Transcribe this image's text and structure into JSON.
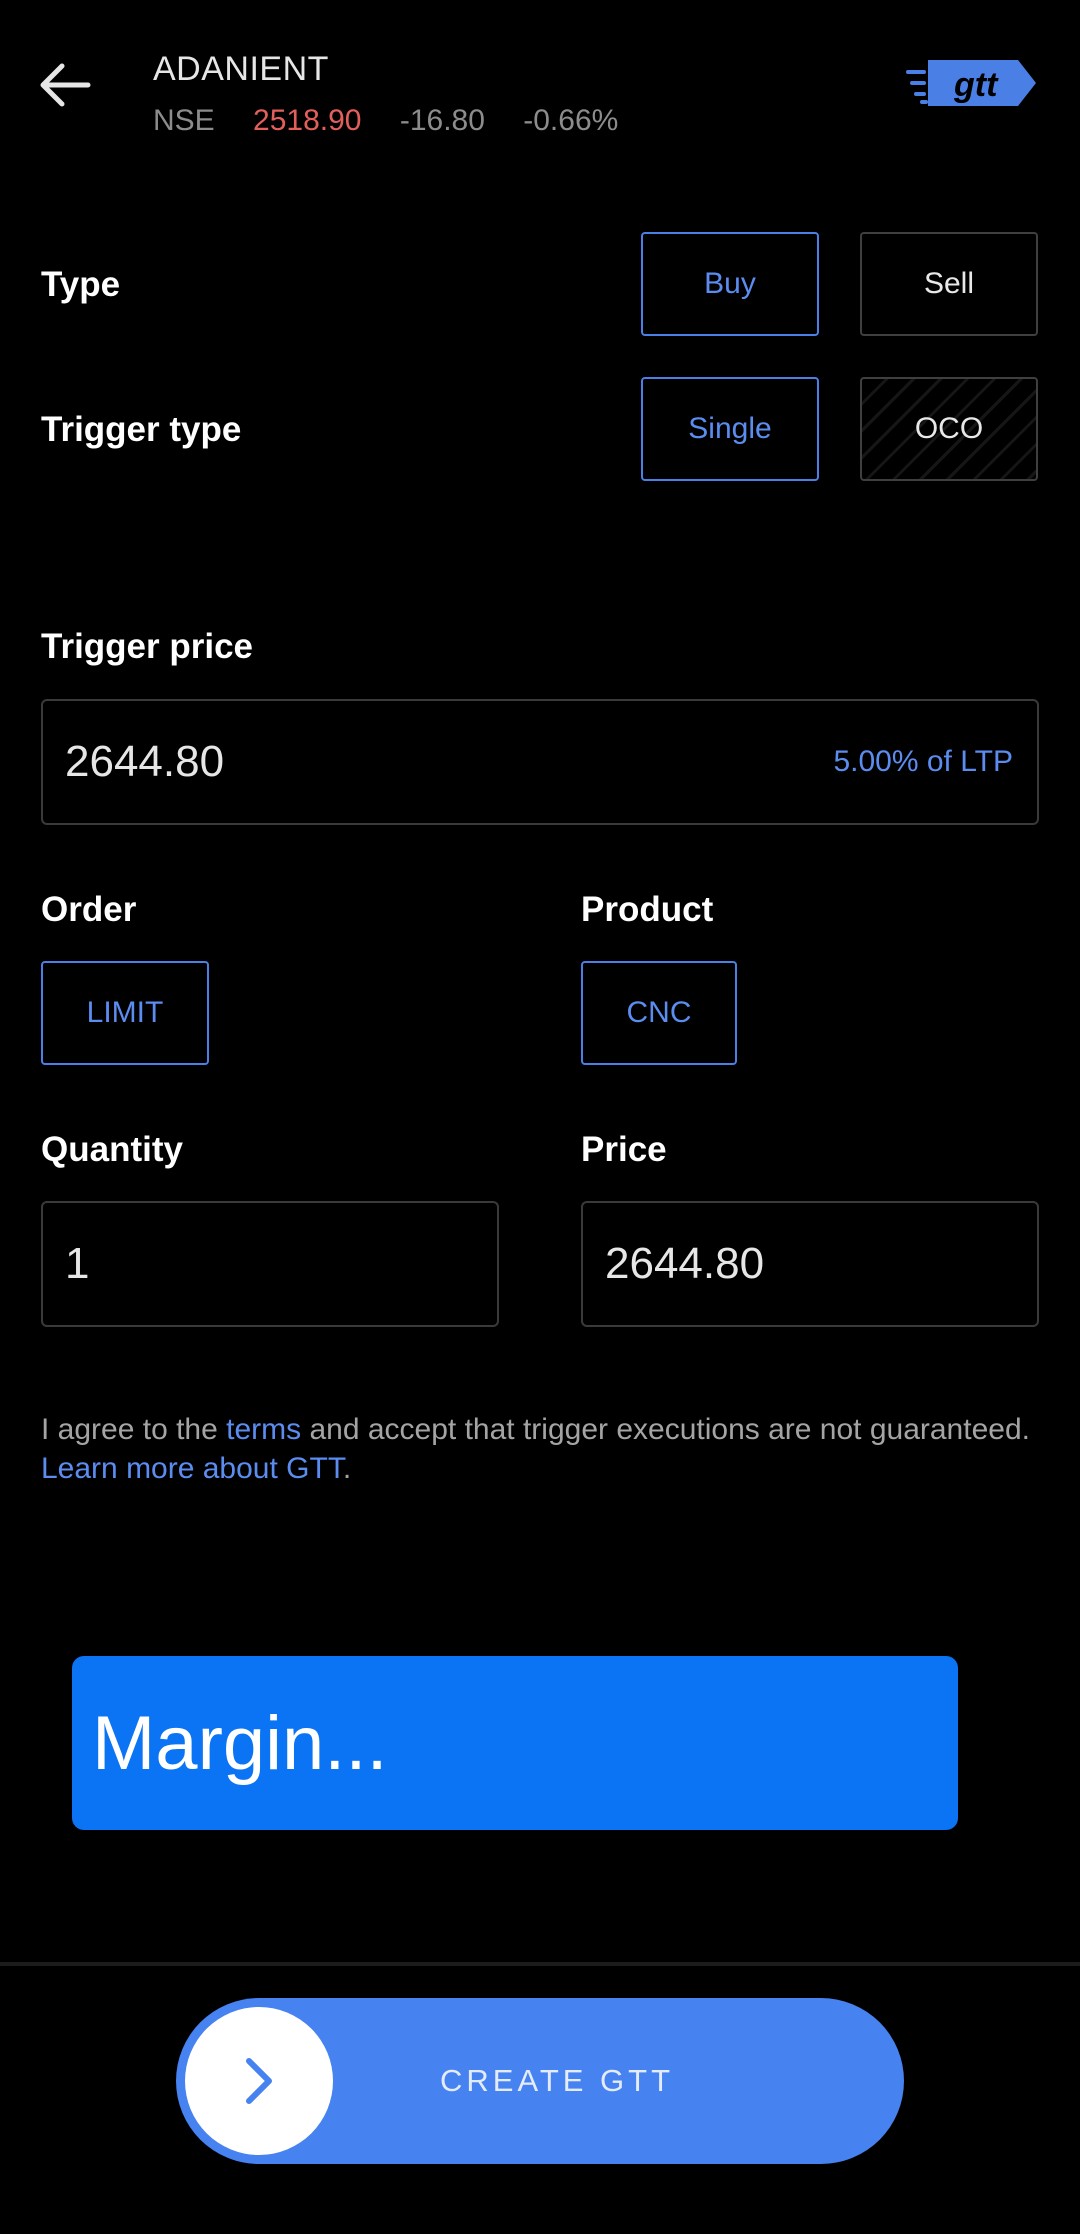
{
  "header": {
    "symbol": "ADANIENT",
    "exchange": "NSE",
    "ltp": "2518.90",
    "change": "-16.80",
    "change_pct": "-0.66%",
    "logo_text": "gtt"
  },
  "type": {
    "label": "Type",
    "options": [
      "Buy",
      "Sell"
    ],
    "selected": "Buy"
  },
  "trigger_type": {
    "label": "Trigger type",
    "options": [
      "Single",
      "OCO"
    ],
    "selected": "Single"
  },
  "trigger_price": {
    "label": "Trigger price",
    "value": "2644.80",
    "ltp_note": "5.00% of LTP"
  },
  "order": {
    "label": "Order",
    "value": "LIMIT"
  },
  "product": {
    "label": "Product",
    "value": "CNC"
  },
  "quantity": {
    "label": "Quantity",
    "value": "1"
  },
  "price": {
    "label": "Price",
    "value": "2644.80"
  },
  "agreement": {
    "prefix": "I agree to the ",
    "terms": "terms",
    "middle": " and accept that trigger executions are not guaranteed.",
    "learn_more": "Learn more about GTT",
    "suffix": "."
  },
  "margin": {
    "label": "Margin..."
  },
  "cta": {
    "label": "CREATE GTT"
  },
  "colors": {
    "accent": "#4a7fe6",
    "loss": "#e25f5b",
    "margin_bg": "#0a74f5",
    "slider_bg": "#4682f0"
  },
  "icons": [
    "back-arrow-icon",
    "gtt-logo-icon",
    "chevron-right-icon"
  ]
}
